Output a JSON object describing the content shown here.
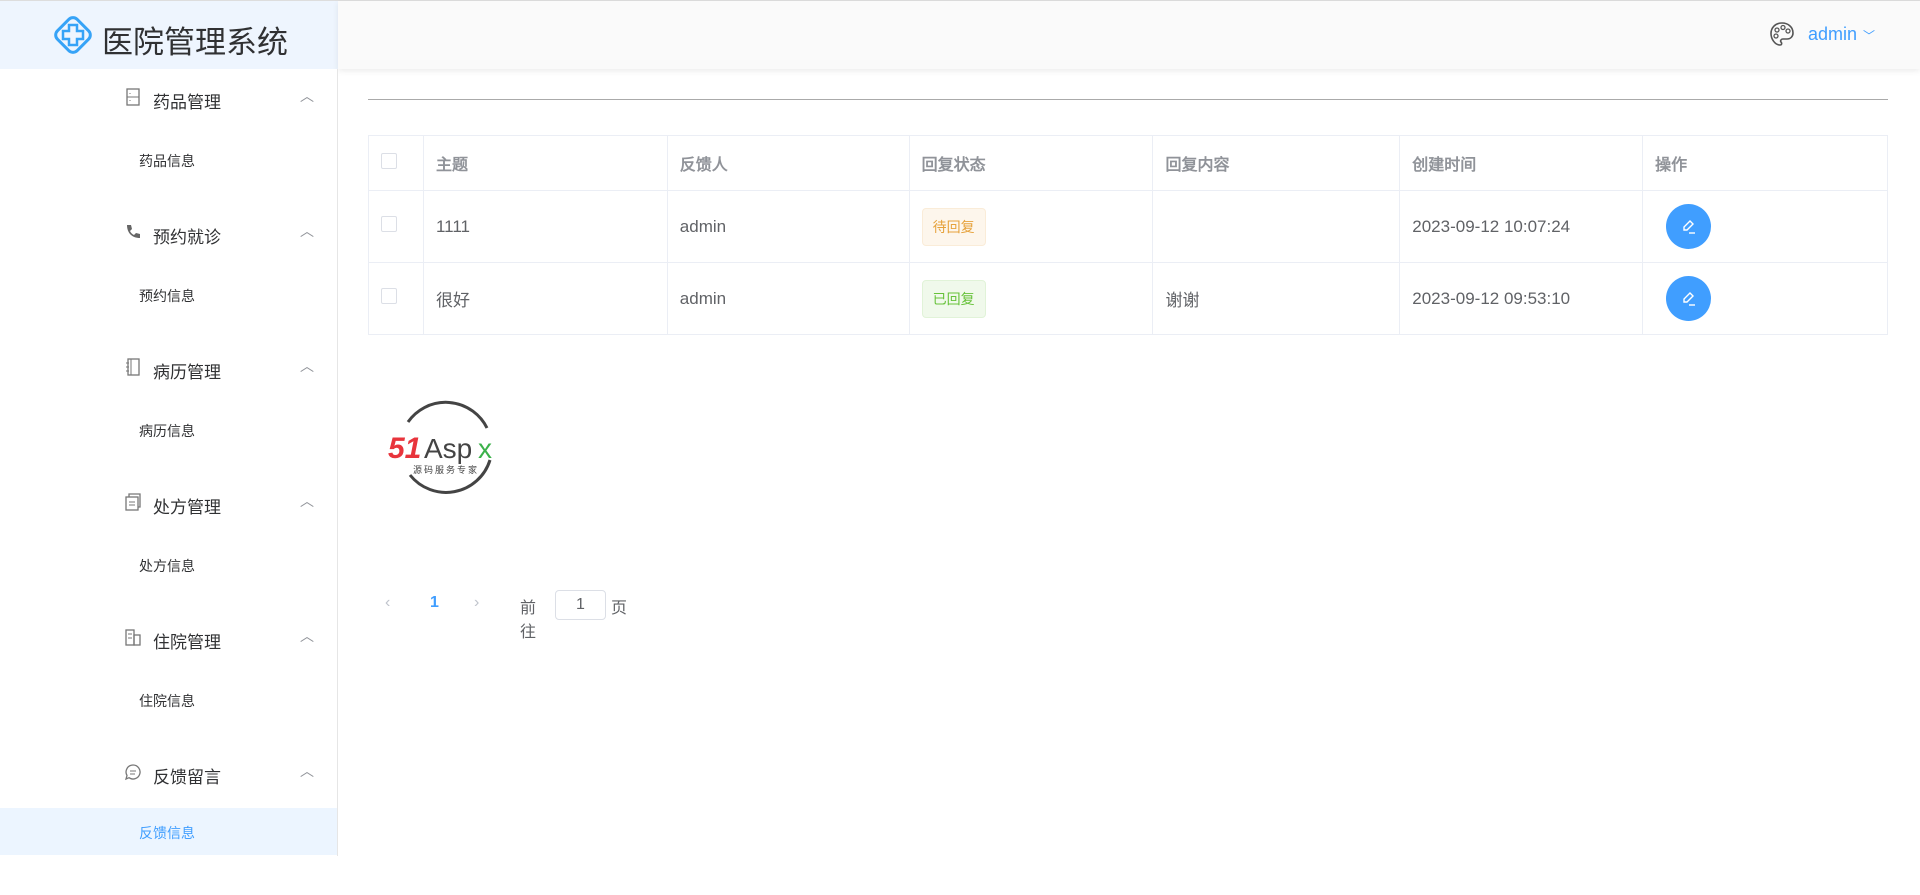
{
  "app": {
    "title": "医院管理系统"
  },
  "header": {
    "user": "admin"
  },
  "sidebar": {
    "groups": [
      {
        "label": "药品管理",
        "icon": "cabinet-icon",
        "sub": "药品信息"
      },
      {
        "label": "预约就诊",
        "icon": "phone-icon",
        "sub": "预约信息"
      },
      {
        "label": "病历管理",
        "icon": "notebook-icon",
        "sub": "病历信息"
      },
      {
        "label": "处方管理",
        "icon": "document-icon",
        "sub": "处方信息"
      },
      {
        "label": "住院管理",
        "icon": "building-icon",
        "sub": "住院信息"
      },
      {
        "label": "反馈留言",
        "icon": "chat-icon",
        "sub": "反馈信息"
      }
    ],
    "active": "反馈信息"
  },
  "table": {
    "headers": [
      "主题",
      "反馈人",
      "回复状态",
      "回复内容",
      "创建时间",
      "操作"
    ],
    "rows": [
      {
        "subject": "1111",
        "user": "admin",
        "status": "待回复",
        "reply": "",
        "created": "2023-09-12 10:07:24"
      },
      {
        "subject": "很好",
        "user": "admin",
        "status": "已回复",
        "reply": "谢谢",
        "created": "2023-09-12 09:53:10"
      }
    ]
  },
  "watermark": {
    "brand": "51Aspx",
    "tagline": "源码服务专家"
  },
  "pagination": {
    "current": "1",
    "goto_label": "前往",
    "goto_value": "1",
    "page_suffix": "页"
  },
  "colors": {
    "primary": "#409eff",
    "warning": "#e6a23c",
    "success": "#67c23a"
  }
}
